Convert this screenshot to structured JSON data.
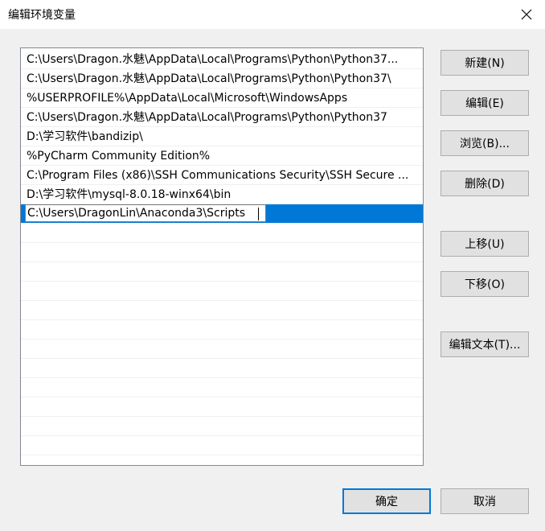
{
  "window": {
    "title": "编辑环境变量"
  },
  "paths": [
    "C:\\Users\\Dragon.水魅\\AppData\\Local\\Programs\\Python\\Python37...",
    "C:\\Users\\Dragon.水魅\\AppData\\Local\\Programs\\Python\\Python37\\",
    "%USERPROFILE%\\AppData\\Local\\Microsoft\\WindowsApps",
    "C:\\Users\\Dragon.水魅\\AppData\\Local\\Programs\\Python\\Python37",
    "D:\\学习软件\\bandizip\\",
    "%PyCharm Community Edition%",
    "C:\\Program Files (x86)\\SSH Communications Security\\SSH Secure ...",
    "D:\\学习软件\\mysql-8.0.18-winx64\\bin"
  ],
  "editing": {
    "value": "C:\\Users\\DragonLin\\Anaconda3\\Scripts"
  },
  "buttons": {
    "new": "新建(N)",
    "edit": "编辑(E)",
    "browse": "浏览(B)...",
    "delete": "删除(D)",
    "move_up": "上移(U)",
    "move_down": "下移(O)",
    "edit_text": "编辑文本(T)...",
    "ok": "确定",
    "cancel": "取消"
  }
}
